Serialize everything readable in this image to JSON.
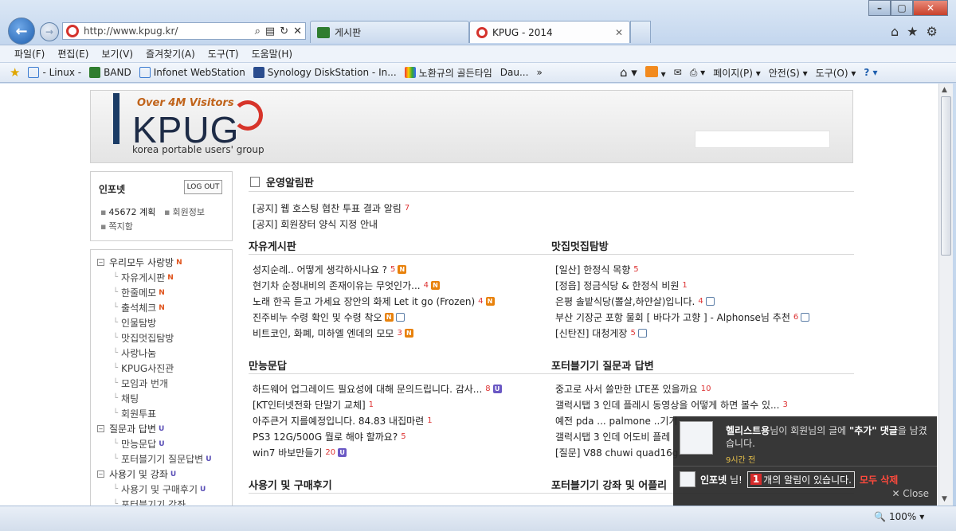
{
  "browser": {
    "address": "http://www.kpug.kr/",
    "tabs": [
      {
        "label": "게시판"
      },
      {
        "label": "KPUG - 2014"
      }
    ],
    "menubar": [
      "파일(F)",
      "편집(E)",
      "보기(V)",
      "즐겨찾기(A)",
      "도구(T)",
      "도움말(H)"
    ],
    "favorites": [
      "- Linux -",
      "BAND",
      "Infonet WebStation",
      "Synology DiskStation - In...",
      "노환규의 골든타임",
      "Dau..."
    ],
    "commands": [
      "페이지(P) ▾",
      "안전(S) ▾",
      "도구(O) ▾"
    ],
    "zoom": "100%",
    "colors": {
      "accent": "#1f5fae",
      "close": "#c8412b"
    }
  },
  "site": {
    "visitors": "Over 4M Visitors",
    "brand": "KPUG",
    "slogan": "korea portable users' group",
    "login": {
      "username": "인포넷",
      "logout": "LOG OUT",
      "points": "45672 계획",
      "profile": "회원정보",
      "messages": "쪽지함"
    },
    "menu": [
      {
        "label": "우리모두 사랑방",
        "level": "top",
        "tag": "N"
      },
      {
        "label": "자유게시판",
        "level": "sub",
        "tag": "N"
      },
      {
        "label": "한줄메모",
        "level": "sub",
        "tag": "N"
      },
      {
        "label": "출석체크",
        "level": "sub",
        "tag": "N"
      },
      {
        "label": "인물탐방",
        "level": "sub",
        "tag": ""
      },
      {
        "label": "맛집멋집탐방",
        "level": "sub",
        "tag": ""
      },
      {
        "label": "사랑나눔",
        "level": "sub",
        "tag": ""
      },
      {
        "label": "KPUG사진관",
        "level": "sub",
        "tag": ""
      },
      {
        "label": "모임과 번개",
        "level": "sub",
        "tag": ""
      },
      {
        "label": "채팅",
        "level": "sub",
        "tag": ""
      },
      {
        "label": "회원투표",
        "level": "sub",
        "tag": ""
      },
      {
        "label": "질문과 답변",
        "level": "top",
        "tag": "U"
      },
      {
        "label": "만능문답",
        "level": "sub",
        "tag": "U"
      },
      {
        "label": "포터블기기 질문답변",
        "level": "sub",
        "tag": "U"
      },
      {
        "label": "사용기 및 강좌",
        "level": "top",
        "tag": "U"
      },
      {
        "label": "사용기 및 구매후기",
        "level": "sub",
        "tag": "U"
      },
      {
        "label": "포터블기기 강좌",
        "level": "sub",
        "tag": ""
      }
    ],
    "notice": {
      "title": "운영알림판",
      "items": [
        {
          "text": "[공지] 웹 호스팅 협찬 투표 결과 알림",
          "count": "7"
        },
        {
          "text": "[공지] 회원장터 양식 지정 안내",
          "count": ""
        }
      ]
    },
    "sections": {
      "free": {
        "title": "자유게시판",
        "items": [
          {
            "text": "성지순례.. 어떻게 생각하시나요 ?",
            "count": "5",
            "icons": [
              "N"
            ]
          },
          {
            "text": "현기차 순정내비의 존재이유는 무엇인가...",
            "count": "4",
            "icons": [
              "N"
            ]
          },
          {
            "text": "노래 한곡 듣고 가세요 장안의 화제 Let it go (Frozen)",
            "count": "4",
            "icons": [
              "N"
            ]
          },
          {
            "text": "진주비누 수령 확인 및 수령 착오",
            "count": "",
            "icons": [
              "N",
              "IMG"
            ]
          },
          {
            "text": "비트코인, 화폐, 미하엘 엔데의 모모",
            "count": "3",
            "icons": [
              "N"
            ]
          }
        ]
      },
      "food": {
        "title": "맛집멋집탐방",
        "items": [
          {
            "text": "[일산] 한정식 목향",
            "count": "5",
            "icons": []
          },
          {
            "text": "[정읍] 정금식당 & 한정식 비원",
            "count": "1",
            "icons": []
          },
          {
            "text": "은평 솔밭식당(뽈살,하얀살)입니다.",
            "count": "4",
            "icons": [
              "IMG"
            ]
          },
          {
            "text": "부산 기장군 포항 물회 [ 바다가 고향 ] - Alphonse님 추천",
            "count": "6",
            "icons": [
              "IMG"
            ]
          },
          {
            "text": "[신탄진] 대청게장",
            "count": "5",
            "icons": [
              "IMG"
            ]
          }
        ]
      },
      "qa": {
        "title": "만능문답",
        "items": [
          {
            "text": "하드웨어 업그레이드 필요성에 대해 문의드립니다. 감사...",
            "count": "8",
            "icons": [
              "U"
            ]
          },
          {
            "text": "[KT인터넷전화 단말기 교체]",
            "count": "1",
            "icons": []
          },
          {
            "text": "아주큰거 지를예정입니다. 84.83 내집마련",
            "count": "1",
            "icons": []
          },
          {
            "text": "PS3 12G/500G 뭘로 해야 할까요?",
            "count": "5",
            "icons": []
          },
          {
            "text": "win7 바보만들기",
            "count": "20",
            "icons": [
              "U"
            ]
          }
        ]
      },
      "portable": {
        "title": "포터블기기 질문과 답변",
        "items": [
          {
            "text": "중고로 사서 쓸만한 LTE폰 있을까요",
            "count": "10",
            "icons": []
          },
          {
            "text": "갤럭시탭 3 인데 플레시 동영상을 어떻게 하면 볼수 있...",
            "count": "3",
            "icons": []
          },
          {
            "text": "예전 pda ... palmone ..기기",
            "count": "",
            "icons": []
          },
          {
            "text": "갤럭시탭 3 인데 어도비 플레",
            "count": "",
            "icons": []
          },
          {
            "text": "[질문] V88 chuwi quad16g",
            "count": "",
            "icons": []
          }
        ]
      },
      "review": {
        "title": "사용기 및 구매후기"
      },
      "lecture": {
        "title": "포터블기기 강좌 및 어플리"
      }
    },
    "popup": {
      "sender": "헬리스트용",
      "msg_mid": "님이 회원님의 글에 ",
      "quote": "\"추가\" 댓글",
      "msg_end": "을 남겼습니다.",
      "time": "9시간 전",
      "user": "인포넷",
      "user_suffix": "님!",
      "alert_count": "1",
      "alert_text": "개의 알림이 있습니다.",
      "delete_all": "모두 삭제",
      "close": "✕ Close"
    }
  }
}
